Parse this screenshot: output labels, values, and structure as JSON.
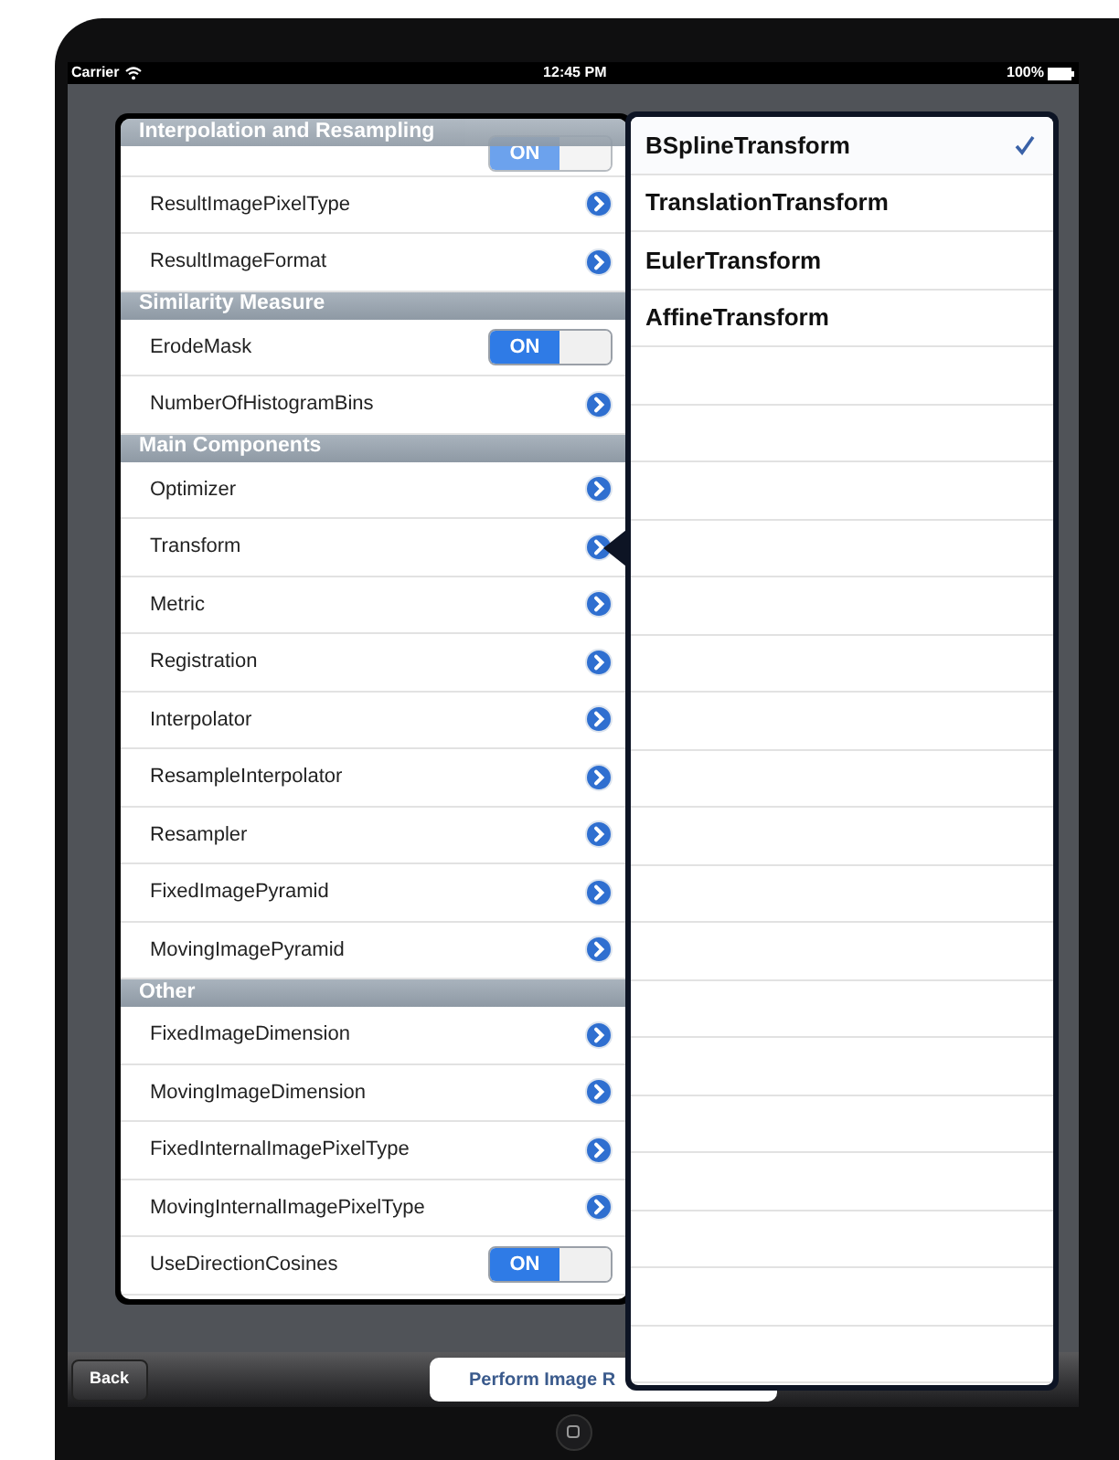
{
  "status_bar": {
    "carrier": "Carrier",
    "time": "12:45 PM",
    "battery": "100%"
  },
  "sections": [
    {
      "title": "Interpolation and Resampling",
      "floating": true,
      "rows": [
        {
          "kind": "switch",
          "on": true,
          "switch_text": "ON"
        },
        {
          "kind": "disclosure",
          "label": "ResultImagePixelType"
        },
        {
          "kind": "disclosure",
          "label": "ResultImageFormat"
        }
      ]
    },
    {
      "title": "Similarity Measure",
      "floating": false,
      "rows": [
        {
          "kind": "switch",
          "label": "ErodeMask",
          "on": true,
          "switch_text": "ON"
        },
        {
          "kind": "disclosure",
          "label": "NumberOfHistogramBins"
        }
      ]
    },
    {
      "title": "Main Components",
      "floating": false,
      "rows": [
        {
          "kind": "disclosure",
          "label": "Optimizer"
        },
        {
          "kind": "disclosure",
          "label": "Transform"
        },
        {
          "kind": "disclosure",
          "label": "Metric"
        },
        {
          "kind": "disclosure",
          "label": "Registration"
        },
        {
          "kind": "disclosure",
          "label": "Interpolator"
        },
        {
          "kind": "disclosure",
          "label": "ResampleInterpolator"
        },
        {
          "kind": "disclosure",
          "label": "Resampler"
        },
        {
          "kind": "disclosure",
          "label": "FixedImagePyramid"
        },
        {
          "kind": "disclosure",
          "label": "MovingImagePyramid"
        }
      ]
    },
    {
      "title": "Other",
      "floating": false,
      "rows": [
        {
          "kind": "disclosure",
          "label": "FixedImageDimension"
        },
        {
          "kind": "disclosure",
          "label": "MovingImageDimension"
        },
        {
          "kind": "disclosure",
          "label": "FixedInternalImagePixelType"
        },
        {
          "kind": "disclosure",
          "label": "MovingInternalImagePixelType"
        },
        {
          "kind": "switch",
          "label": "UseDirectionCosines",
          "on": true,
          "switch_text": "ON"
        }
      ]
    }
  ],
  "popover": {
    "options": [
      {
        "label": "BSplineTransform",
        "selected": true
      },
      {
        "label": "TranslationTransform",
        "selected": false
      },
      {
        "label": "EulerTransform",
        "selected": false
      },
      {
        "label": "AffineTransform",
        "selected": false
      }
    ]
  },
  "toolbar": {
    "back_button": "Back",
    "action_button": "Perform Image R"
  }
}
